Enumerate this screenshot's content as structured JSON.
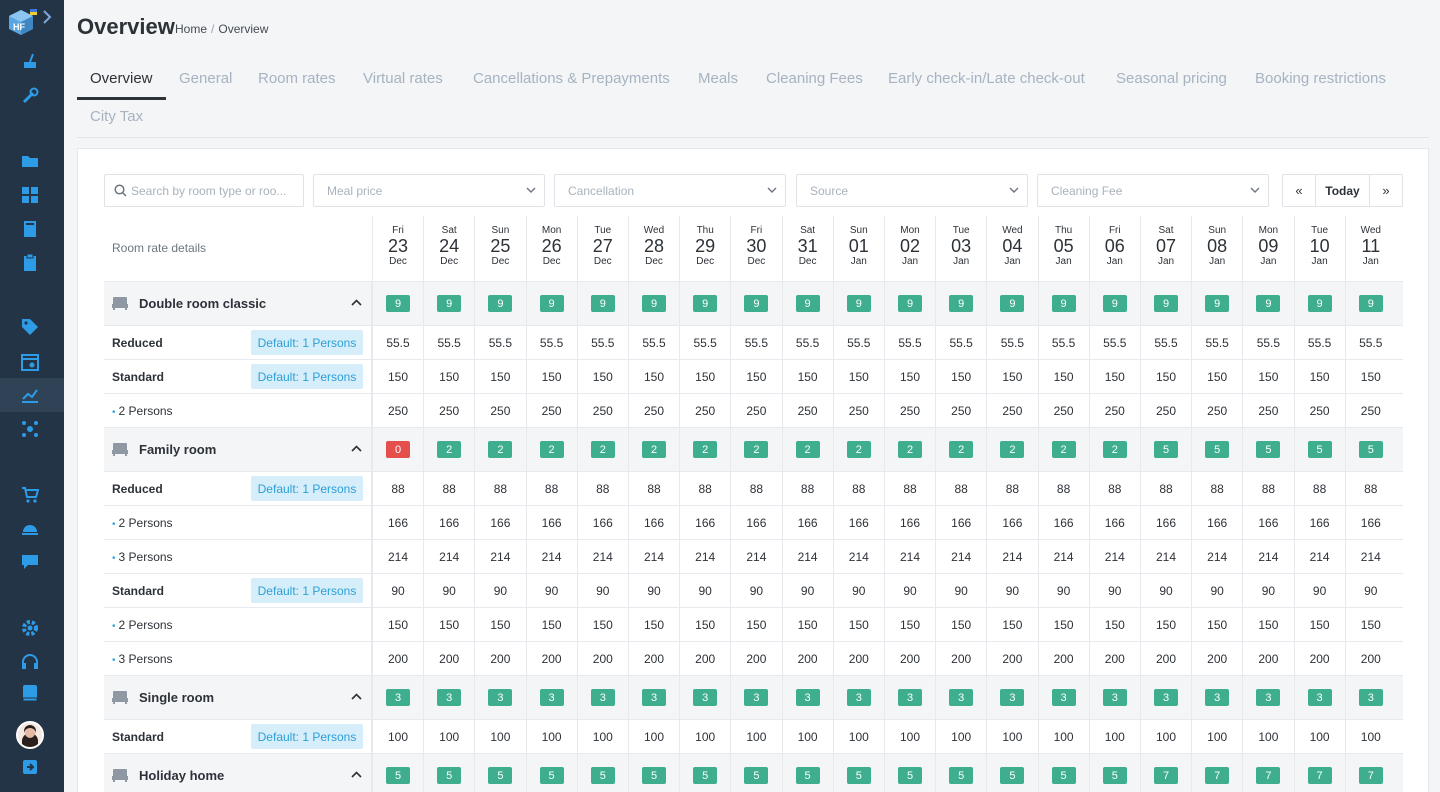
{
  "header": {
    "title": "Overview",
    "breadcrumb": [
      "Home",
      "/",
      "Overview"
    ]
  },
  "tabs": [
    {
      "label": "Overview",
      "active": true
    },
    {
      "label": "General"
    },
    {
      "label": "Room rates"
    },
    {
      "label": "Virtual rates"
    },
    {
      "label": "Cancellations & Prepayments"
    },
    {
      "label": "Meals"
    },
    {
      "label": "Cleaning Fees"
    },
    {
      "label": "Early check-in/Late check-out"
    },
    {
      "label": "Seasonal pricing"
    },
    {
      "label": "Booking restrictions"
    },
    {
      "label": "City Tax"
    }
  ],
  "filters": {
    "search_placeholder": "Search by room type or roo...",
    "meal": "Meal price",
    "cancellation": "Cancellation",
    "source": "Source",
    "cleaning": "Cleaning Fee"
  },
  "nav": {
    "prev": "«",
    "today": "Today",
    "next": "»"
  },
  "grid": {
    "label": "Room rate details",
    "dates": [
      {
        "dow": "Fri",
        "day": "23",
        "mon": "Dec"
      },
      {
        "dow": "Sat",
        "day": "24",
        "mon": "Dec"
      },
      {
        "dow": "Sun",
        "day": "25",
        "mon": "Dec"
      },
      {
        "dow": "Mon",
        "day": "26",
        "mon": "Dec"
      },
      {
        "dow": "Tue",
        "day": "27",
        "mon": "Dec"
      },
      {
        "dow": "Wed",
        "day": "28",
        "mon": "Dec"
      },
      {
        "dow": "Thu",
        "day": "29",
        "mon": "Dec"
      },
      {
        "dow": "Fri",
        "day": "30",
        "mon": "Dec"
      },
      {
        "dow": "Sat",
        "day": "31",
        "mon": "Dec"
      },
      {
        "dow": "Sun",
        "day": "01",
        "mon": "Jan"
      },
      {
        "dow": "Mon",
        "day": "02",
        "mon": "Jan"
      },
      {
        "dow": "Tue",
        "day": "03",
        "mon": "Jan"
      },
      {
        "dow": "Wed",
        "day": "04",
        "mon": "Jan"
      },
      {
        "dow": "Thu",
        "day": "05",
        "mon": "Jan"
      },
      {
        "dow": "Fri",
        "day": "06",
        "mon": "Jan"
      },
      {
        "dow": "Sat",
        "day": "07",
        "mon": "Jan"
      },
      {
        "dow": "Sun",
        "day": "08",
        "mon": "Jan"
      },
      {
        "dow": "Mon",
        "day": "09",
        "mon": "Jan"
      },
      {
        "dow": "Tue",
        "day": "10",
        "mon": "Jan"
      },
      {
        "dow": "Wed",
        "day": "11",
        "mon": "Jan"
      }
    ],
    "rows": [
      {
        "type": "room",
        "name": "Double room classic",
        "availability": [
          "9",
          "9",
          "9",
          "9",
          "9",
          "9",
          "9",
          "9",
          "9",
          "9",
          "9",
          "9",
          "9",
          "9",
          "9",
          "9",
          "9",
          "9",
          "9",
          "9"
        ]
      },
      {
        "type": "rate",
        "name": "Reduced",
        "bold": true,
        "badge": "Default: 1 Persons",
        "values": [
          "55.5",
          "55.5",
          "55.5",
          "55.5",
          "55.5",
          "55.5",
          "55.5",
          "55.5",
          "55.5",
          "55.5",
          "55.5",
          "55.5",
          "55.5",
          "55.5",
          "55.5",
          "55.5",
          "55.5",
          "55.5",
          "55.5",
          "55.5"
        ]
      },
      {
        "type": "rate",
        "name": "Standard",
        "bold": true,
        "badge": "Default: 1 Persons",
        "values": [
          "150",
          "150",
          "150",
          "150",
          "150",
          "150",
          "150",
          "150",
          "150",
          "150",
          "150",
          "150",
          "150",
          "150",
          "150",
          "150",
          "150",
          "150",
          "150",
          "150"
        ]
      },
      {
        "type": "rate",
        "name": "2 Persons",
        "sub": true,
        "values": [
          "250",
          "250",
          "250",
          "250",
          "250",
          "250",
          "250",
          "250",
          "250",
          "250",
          "250",
          "250",
          "250",
          "250",
          "250",
          "250",
          "250",
          "250",
          "250",
          "250"
        ]
      },
      {
        "type": "room",
        "name": "Family room",
        "availability": [
          "0",
          "2",
          "2",
          "2",
          "2",
          "2",
          "2",
          "2",
          "2",
          "2",
          "2",
          "2",
          "2",
          "2",
          "2",
          "5",
          "5",
          "5",
          "5",
          "5"
        ]
      },
      {
        "type": "rate",
        "name": "Reduced",
        "bold": true,
        "badge": "Default: 1 Persons",
        "values": [
          "88",
          "88",
          "88",
          "88",
          "88",
          "88",
          "88",
          "88",
          "88",
          "88",
          "88",
          "88",
          "88",
          "88",
          "88",
          "88",
          "88",
          "88",
          "88",
          "88"
        ]
      },
      {
        "type": "rate",
        "name": "2 Persons",
        "sub": true,
        "values": [
          "166",
          "166",
          "166",
          "166",
          "166",
          "166",
          "166",
          "166",
          "166",
          "166",
          "166",
          "166",
          "166",
          "166",
          "166",
          "166",
          "166",
          "166",
          "166",
          "166"
        ]
      },
      {
        "type": "rate",
        "name": "3 Persons",
        "sub": true,
        "values": [
          "214",
          "214",
          "214",
          "214",
          "214",
          "214",
          "214",
          "214",
          "214",
          "214",
          "214",
          "214",
          "214",
          "214",
          "214",
          "214",
          "214",
          "214",
          "214",
          "214"
        ]
      },
      {
        "type": "rate",
        "name": "Standard",
        "bold": true,
        "badge": "Default: 1 Persons",
        "values": [
          "90",
          "90",
          "90",
          "90",
          "90",
          "90",
          "90",
          "90",
          "90",
          "90",
          "90",
          "90",
          "90",
          "90",
          "90",
          "90",
          "90",
          "90",
          "90",
          "90"
        ]
      },
      {
        "type": "rate",
        "name": "2 Persons",
        "sub": true,
        "values": [
          "150",
          "150",
          "150",
          "150",
          "150",
          "150",
          "150",
          "150",
          "150",
          "150",
          "150",
          "150",
          "150",
          "150",
          "150",
          "150",
          "150",
          "150",
          "150",
          "150"
        ]
      },
      {
        "type": "rate",
        "name": "3 Persons",
        "sub": true,
        "values": [
          "200",
          "200",
          "200",
          "200",
          "200",
          "200",
          "200",
          "200",
          "200",
          "200",
          "200",
          "200",
          "200",
          "200",
          "200",
          "200",
          "200",
          "200",
          "200",
          "200"
        ]
      },
      {
        "type": "room",
        "name": "Single room",
        "availability": [
          "3",
          "3",
          "3",
          "3",
          "3",
          "3",
          "3",
          "3",
          "3",
          "3",
          "3",
          "3",
          "3",
          "3",
          "3",
          "3",
          "3",
          "3",
          "3",
          "3"
        ]
      },
      {
        "type": "rate",
        "name": "Standard",
        "bold": true,
        "badge": "Default: 1 Persons",
        "values": [
          "100",
          "100",
          "100",
          "100",
          "100",
          "100",
          "100",
          "100",
          "100",
          "100",
          "100",
          "100",
          "100",
          "100",
          "100",
          "100",
          "100",
          "100",
          "100",
          "100"
        ]
      },
      {
        "type": "room",
        "name": "Holiday home",
        "availability": [
          "5",
          "5",
          "5",
          "5",
          "5",
          "5",
          "5",
          "5",
          "5",
          "5",
          "5",
          "5",
          "5",
          "5",
          "5",
          "7",
          "7",
          "7",
          "7",
          "7"
        ]
      }
    ]
  }
}
